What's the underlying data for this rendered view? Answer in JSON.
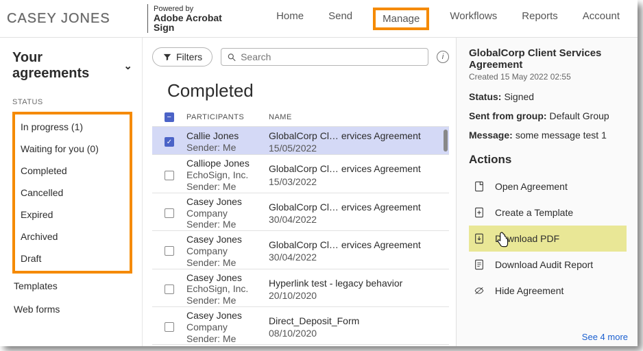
{
  "header": {
    "logo": "CASEY JONES",
    "powered_label": "Powered by",
    "powered_brand": "Adobe Acrobat Sign",
    "nav": [
      "Home",
      "Send",
      "Manage",
      "Workflows",
      "Reports",
      "Account"
    ],
    "active_index": 2
  },
  "sidebar": {
    "title": "Your agreements",
    "status_label": "STATUS",
    "boxed_items": [
      "In progress (1)",
      "Waiting for you (0)",
      "Completed",
      "Cancelled",
      "Expired",
      "Archived",
      "Draft"
    ],
    "below_items": [
      "Templates",
      "Web forms"
    ]
  },
  "center": {
    "filters_label": "Filters",
    "search_placeholder": "Search",
    "section_title": "Completed",
    "columns": {
      "participants": "PARTICIPANTS",
      "name": "NAME"
    },
    "rows": [
      {
        "p1": "Callie Jones",
        "p2": "",
        "p3": "Sender: Me",
        "n1": "GlobalCorp Cl… ervices Agreement",
        "n2": "15/05/2022",
        "selected": true
      },
      {
        "p1": "Calliope Jones",
        "p2": "EchoSign, Inc.",
        "p3": "Sender: Me",
        "n1": "GlobalCorp Cl… ervices Agreement",
        "n2": "15/03/2022",
        "selected": false
      },
      {
        "p1": "Casey Jones",
        "p2": "Company",
        "p3": "Sender: Me",
        "n1": "GlobalCorp Cl… ervices Agreement",
        "n2": "30/04/2022",
        "selected": false
      },
      {
        "p1": "Casey Jones",
        "p2": "Company",
        "p3": "Sender: Me",
        "n1": "GlobalCorp Cl… ervices Agreement",
        "n2": "30/04/2022",
        "selected": false
      },
      {
        "p1": "Casey Jones",
        "p2": "EchoSign, Inc.",
        "p3": "Sender: Me",
        "n1": "Hyperlink test - legacy behavior",
        "n2": "20/10/2020",
        "selected": false
      },
      {
        "p1": "Casey Jones",
        "p2": "Company",
        "p3": "Sender: Me",
        "n1": "Direct_Deposit_Form",
        "n2": "08/10/2020",
        "selected": false
      }
    ]
  },
  "rpanel": {
    "title": "GlobalCorp Client Services Agreement",
    "created": "Created 15 May 2022 02:55",
    "status_label": "Status:",
    "status_value": "Signed",
    "group_label": "Sent from group:",
    "group_value": "Default Group",
    "message_label": "Message:",
    "message_value": "some message test 1",
    "actions_label": "Actions",
    "actions": [
      "Open Agreement",
      "Create a Template",
      "Download PDF",
      "Download Audit Report",
      "Hide Agreement"
    ],
    "highlight_index": 2,
    "see_more": "See 4 more"
  }
}
